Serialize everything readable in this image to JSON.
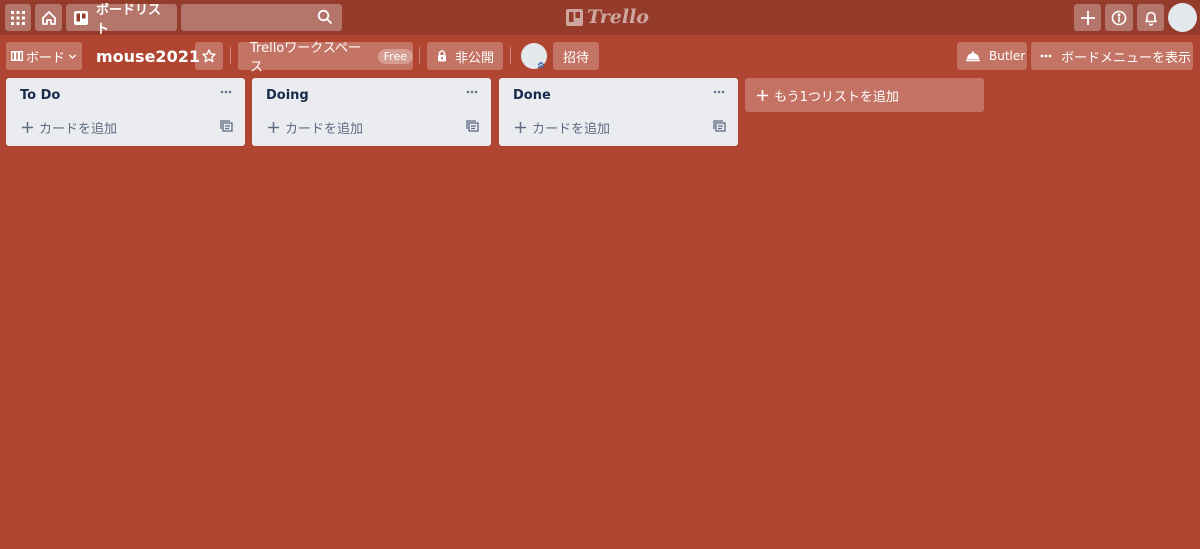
{
  "header": {
    "boards_label": "ボードリスト",
    "search_value": "",
    "logo_text": "Trello"
  },
  "board": {
    "board_switch_label": "ボード",
    "title": "mouse2021",
    "workspace_label": "Trelloワークスペース",
    "workspace_badge": "Free",
    "visibility_label": "非公開",
    "invite_label": "招待",
    "butler_label": "Butler",
    "menu_label": "ボードメニューを表示"
  },
  "lists": [
    {
      "title": "To Do",
      "add_card_label": "カードを追加"
    },
    {
      "title": "Doing",
      "add_card_label": "カードを追加"
    },
    {
      "title": "Done",
      "add_card_label": "カードを追加"
    }
  ],
  "add_list_label": "もう1つリストを追加",
  "colors": {
    "background": "#b04632",
    "header": "#943b2b",
    "list": "#ebecf0",
    "list_text": "#172b4d"
  },
  "icons": {
    "apps": "apps-grid-icon",
    "home": "home-icon",
    "boards": "boards-icon",
    "search": "search-icon",
    "create": "plus-icon",
    "info": "info-icon",
    "notifications": "bell-icon",
    "star": "star-icon",
    "lock": "lock-icon",
    "butler": "butler-icon",
    "more": "more-icon",
    "template": "card-template-icon"
  }
}
